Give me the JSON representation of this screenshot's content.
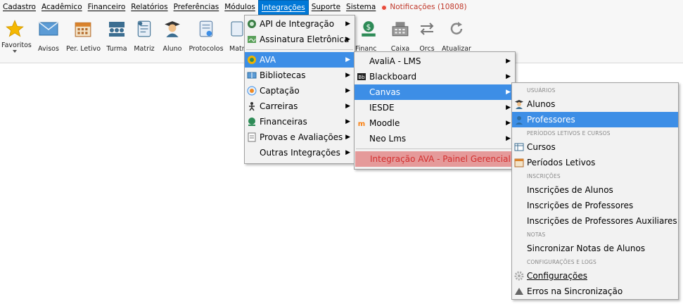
{
  "menubar": {
    "items": [
      "Cadastro",
      "Acadêmico",
      "Financeiro",
      "Relatórios",
      "Preferências",
      "Módulos",
      "Integrações",
      "Suporte",
      "Sistema"
    ],
    "notifications": "Notificações (10808)"
  },
  "toolbar": {
    "buttons": [
      "Favoritos",
      "Avisos",
      "Per. Letivo",
      "Turma",
      "Matriz",
      "Aluno",
      "Protocolos",
      "Matr",
      "Financ",
      "Caixa",
      "Orcs",
      "Atualizar"
    ]
  },
  "integracoes_menu": {
    "items": [
      "API de Integração",
      "Assinatura Eletrônica",
      "AVA",
      "Bibliotecas",
      "Captação",
      "Carreiras",
      "Financeiras",
      "Provas e Avaliações",
      "Outras Integrações"
    ]
  },
  "ava_menu": {
    "items": [
      "AvaliA - LMS",
      "Blackboard",
      "Canvas",
      "IESDE",
      "Moodle",
      "Neo Lms"
    ],
    "footer": "Integração AVA - Painel Gerencial"
  },
  "canvas_menu": {
    "section_usuarios": "USUÁRIOS",
    "alunos": "Alunos",
    "professores": "Professores",
    "section_periodos": "PERÍODOS LETIVOS E CURSOS",
    "cursos": "Cursos",
    "periodos_letivos": "Períodos Letivos",
    "section_inscricoes": "INSCRIÇÕES",
    "inscricoes_alunos": "Inscrições de Alunos",
    "inscricoes_professores": "Inscrições de Professores",
    "inscricoes_prof_aux": "Inscrições de Professores Auxiliares",
    "section_notas": "NOTAS",
    "sincronizar_notas": "Sincronizar Notas de Alunos",
    "section_config": "CONFIGURAÇÕES E LOGS",
    "configuracoes": "Configurações",
    "erros": "Erros na Sincronização"
  },
  "colors": {
    "highlight": "#3d8ee6",
    "active_menu": "#0078d7",
    "notification": "#c0392b",
    "footer_text": "#d32f2f"
  },
  "icons": [
    "star-icon",
    "envelope-icon",
    "calendar-icon",
    "group-icon",
    "document-icon",
    "student-icon",
    "form-icon",
    "money-icon",
    "register-icon",
    "swap-icon",
    "refresh-icon"
  ]
}
